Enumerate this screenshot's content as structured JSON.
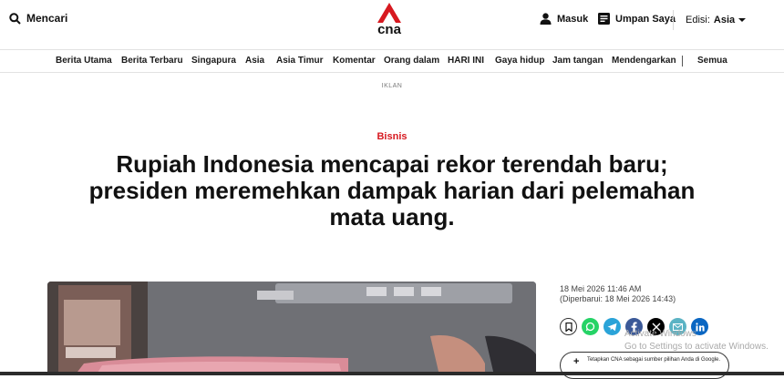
{
  "header": {
    "search_label": "Mencari",
    "logo_text": "cna",
    "login_label": "Masuk",
    "feed_label": "Umpan Saya",
    "edition_prefix": "Edisi:",
    "edition_value": "Asia"
  },
  "nav": {
    "items": [
      "Berita Utama",
      "Berita Terbaru",
      "Singapura",
      "Asia",
      "Asia Timur",
      "Komentar",
      "Orang dalam",
      "HARI INI",
      "Gaya hidup",
      "Jam tangan",
      "Mendengarkan",
      "Semua"
    ]
  },
  "ad_label": "IKLAN",
  "article": {
    "section": "Bisnis",
    "headline": "Rupiah Indonesia mencapai rekor terendah baru; presiden meremehkan dampak harian dari pelemahan mata uang.",
    "published": "18 Mei 2026 11:46 AM",
    "updated": "(Diperbarui: 18 Mei 2026 14:43)",
    "google_source_label": "Tetapkan CNA sebagai sumber pilihan Anda di Google."
  },
  "share_icons": [
    "bookmark-icon",
    "whatsapp-icon",
    "telegram-icon",
    "facebook-icon",
    "x-icon",
    "email-icon",
    "linkedin-icon"
  ],
  "colors": {
    "brand_red": "#d71920",
    "whatsapp": "#25d366",
    "telegram": "#2aa3d8",
    "facebook": "#3b5998",
    "x": "#000000",
    "email": "#5bb3c4",
    "linkedin": "#0a66c2"
  },
  "watermark": {
    "line1": "Activate Windows",
    "line2": "Go to Settings to activate Windows."
  }
}
